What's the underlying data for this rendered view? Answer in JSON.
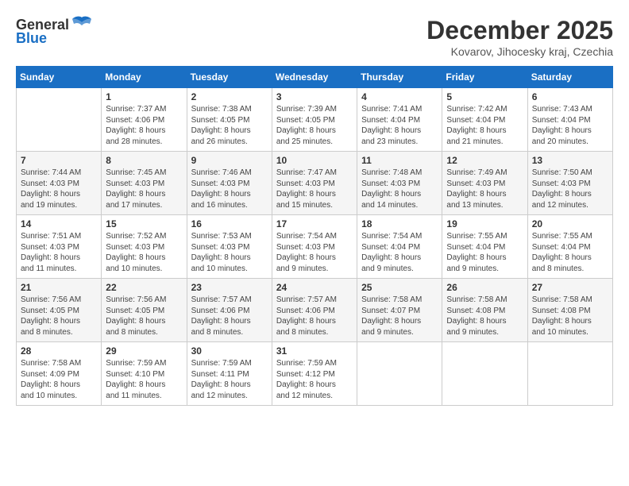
{
  "header": {
    "logo_general": "General",
    "logo_blue": "Blue",
    "month_title": "December 2025",
    "location": "Kovarov, Jihocesky kraj, Czechia"
  },
  "weekdays": [
    "Sunday",
    "Monday",
    "Tuesday",
    "Wednesday",
    "Thursday",
    "Friday",
    "Saturday"
  ],
  "weeks": [
    [
      {
        "day": "",
        "info": ""
      },
      {
        "day": "1",
        "info": "Sunrise: 7:37 AM\nSunset: 4:06 PM\nDaylight: 8 hours\nand 28 minutes."
      },
      {
        "day": "2",
        "info": "Sunrise: 7:38 AM\nSunset: 4:05 PM\nDaylight: 8 hours\nand 26 minutes."
      },
      {
        "day": "3",
        "info": "Sunrise: 7:39 AM\nSunset: 4:05 PM\nDaylight: 8 hours\nand 25 minutes."
      },
      {
        "day": "4",
        "info": "Sunrise: 7:41 AM\nSunset: 4:04 PM\nDaylight: 8 hours\nand 23 minutes."
      },
      {
        "day": "5",
        "info": "Sunrise: 7:42 AM\nSunset: 4:04 PM\nDaylight: 8 hours\nand 21 minutes."
      },
      {
        "day": "6",
        "info": "Sunrise: 7:43 AM\nSunset: 4:04 PM\nDaylight: 8 hours\nand 20 minutes."
      }
    ],
    [
      {
        "day": "7",
        "info": "Sunrise: 7:44 AM\nSunset: 4:03 PM\nDaylight: 8 hours\nand 19 minutes."
      },
      {
        "day": "8",
        "info": "Sunrise: 7:45 AM\nSunset: 4:03 PM\nDaylight: 8 hours\nand 17 minutes."
      },
      {
        "day": "9",
        "info": "Sunrise: 7:46 AM\nSunset: 4:03 PM\nDaylight: 8 hours\nand 16 minutes."
      },
      {
        "day": "10",
        "info": "Sunrise: 7:47 AM\nSunset: 4:03 PM\nDaylight: 8 hours\nand 15 minutes."
      },
      {
        "day": "11",
        "info": "Sunrise: 7:48 AM\nSunset: 4:03 PM\nDaylight: 8 hours\nand 14 minutes."
      },
      {
        "day": "12",
        "info": "Sunrise: 7:49 AM\nSunset: 4:03 PM\nDaylight: 8 hours\nand 13 minutes."
      },
      {
        "day": "13",
        "info": "Sunrise: 7:50 AM\nSunset: 4:03 PM\nDaylight: 8 hours\nand 12 minutes."
      }
    ],
    [
      {
        "day": "14",
        "info": "Sunrise: 7:51 AM\nSunset: 4:03 PM\nDaylight: 8 hours\nand 11 minutes."
      },
      {
        "day": "15",
        "info": "Sunrise: 7:52 AM\nSunset: 4:03 PM\nDaylight: 8 hours\nand 10 minutes."
      },
      {
        "day": "16",
        "info": "Sunrise: 7:53 AM\nSunset: 4:03 PM\nDaylight: 8 hours\nand 10 minutes."
      },
      {
        "day": "17",
        "info": "Sunrise: 7:54 AM\nSunset: 4:03 PM\nDaylight: 8 hours\nand 9 minutes."
      },
      {
        "day": "18",
        "info": "Sunrise: 7:54 AM\nSunset: 4:04 PM\nDaylight: 8 hours\nand 9 minutes."
      },
      {
        "day": "19",
        "info": "Sunrise: 7:55 AM\nSunset: 4:04 PM\nDaylight: 8 hours\nand 9 minutes."
      },
      {
        "day": "20",
        "info": "Sunrise: 7:55 AM\nSunset: 4:04 PM\nDaylight: 8 hours\nand 8 minutes."
      }
    ],
    [
      {
        "day": "21",
        "info": "Sunrise: 7:56 AM\nSunset: 4:05 PM\nDaylight: 8 hours\nand 8 minutes."
      },
      {
        "day": "22",
        "info": "Sunrise: 7:56 AM\nSunset: 4:05 PM\nDaylight: 8 hours\nand 8 minutes."
      },
      {
        "day": "23",
        "info": "Sunrise: 7:57 AM\nSunset: 4:06 PM\nDaylight: 8 hours\nand 8 minutes."
      },
      {
        "day": "24",
        "info": "Sunrise: 7:57 AM\nSunset: 4:06 PM\nDaylight: 8 hours\nand 8 minutes."
      },
      {
        "day": "25",
        "info": "Sunrise: 7:58 AM\nSunset: 4:07 PM\nDaylight: 8 hours\nand 9 minutes."
      },
      {
        "day": "26",
        "info": "Sunrise: 7:58 AM\nSunset: 4:08 PM\nDaylight: 8 hours\nand 9 minutes."
      },
      {
        "day": "27",
        "info": "Sunrise: 7:58 AM\nSunset: 4:08 PM\nDaylight: 8 hours\nand 10 minutes."
      }
    ],
    [
      {
        "day": "28",
        "info": "Sunrise: 7:58 AM\nSunset: 4:09 PM\nDaylight: 8 hours\nand 10 minutes."
      },
      {
        "day": "29",
        "info": "Sunrise: 7:59 AM\nSunset: 4:10 PM\nDaylight: 8 hours\nand 11 minutes."
      },
      {
        "day": "30",
        "info": "Sunrise: 7:59 AM\nSunset: 4:11 PM\nDaylight: 8 hours\nand 12 minutes."
      },
      {
        "day": "31",
        "info": "Sunrise: 7:59 AM\nSunset: 4:12 PM\nDaylight: 8 hours\nand 12 minutes."
      },
      {
        "day": "",
        "info": ""
      },
      {
        "day": "",
        "info": ""
      },
      {
        "day": "",
        "info": ""
      }
    ]
  ]
}
